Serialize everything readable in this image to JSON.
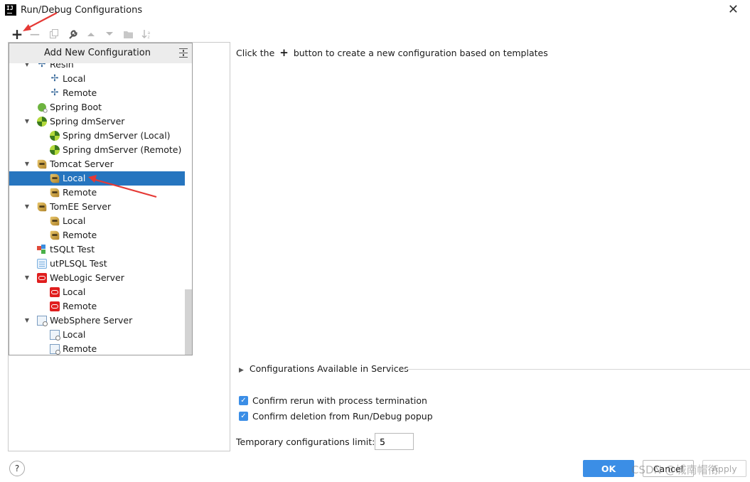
{
  "window": {
    "title": "Run/Debug Configurations",
    "logo_text": "IJ"
  },
  "toolbar": {
    "add": "+",
    "remove": "−"
  },
  "popup": {
    "title": "Add New Configuration",
    "items": [
      {
        "label": "Resin",
        "icon": "resin-icon"
      },
      {
        "label": "Local",
        "icon": "resin-icon"
      },
      {
        "label": "Remote",
        "icon": "resin-icon"
      },
      {
        "label": "Spring Boot",
        "icon": "spring-boot-icon"
      },
      {
        "label": "Spring dmServer",
        "icon": "spring-icon"
      },
      {
        "label": "Spring dmServer (Local)",
        "icon": "spring-icon"
      },
      {
        "label": "Spring dmServer (Remote)",
        "icon": "spring-icon"
      },
      {
        "label": "Tomcat Server",
        "icon": "tomcat-icon"
      },
      {
        "label": "Local",
        "icon": "tomcat-icon"
      },
      {
        "label": "Remote",
        "icon": "tomcat-icon"
      },
      {
        "label": "TomEE Server",
        "icon": "tomcat-icon"
      },
      {
        "label": "Local",
        "icon": "tomcat-icon"
      },
      {
        "label": "Remote",
        "icon": "tomcat-icon"
      },
      {
        "label": "tSQLt Test",
        "icon": "tsqlt-icon"
      },
      {
        "label": "utPLSQL Test",
        "icon": "utplsql-icon"
      },
      {
        "label": "WebLogic Server",
        "icon": "weblogic-icon"
      },
      {
        "label": "Local",
        "icon": "weblogic-icon"
      },
      {
        "label": "Remote",
        "icon": "weblogic-icon"
      },
      {
        "label": "WebSphere Server",
        "icon": "websphere-icon"
      },
      {
        "label": "Local",
        "icon": "websphere-icon"
      },
      {
        "label": "Remote",
        "icon": "websphere-icon"
      }
    ],
    "selected": "Tomcat Server / Local"
  },
  "main": {
    "hint_before": "Click the",
    "hint_plus": "+",
    "hint_after": "button to create a new configuration based on templates",
    "services_label": "Configurations Available in Services",
    "confirm_rerun": "Confirm rerun with process termination",
    "confirm_deletion": "Confirm deletion from Run/Debug popup",
    "limit_label": "Temporary configurations limit:",
    "limit_value": "5"
  },
  "buttons": {
    "help": "?",
    "ok": "OK",
    "cancel": "Cancel",
    "apply": "Apply"
  },
  "watermark": "CSDN @城南帽衔",
  "colors": {
    "selection": "#2675bf",
    "accent": "#3b8ee6",
    "annotation": "#e53935"
  }
}
